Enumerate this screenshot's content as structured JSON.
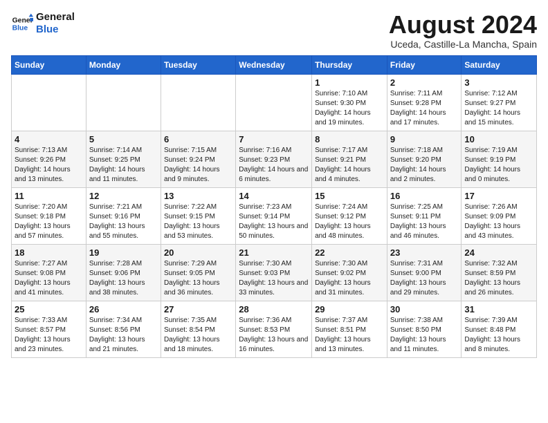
{
  "logo": {
    "line1": "General",
    "line2": "Blue"
  },
  "title": "August 2024",
  "subtitle": "Uceda, Castille-La Mancha, Spain",
  "weekdays": [
    "Sunday",
    "Monday",
    "Tuesday",
    "Wednesday",
    "Thursday",
    "Friday",
    "Saturday"
  ],
  "weeks": [
    [
      {
        "day": "",
        "info": ""
      },
      {
        "day": "",
        "info": ""
      },
      {
        "day": "",
        "info": ""
      },
      {
        "day": "",
        "info": ""
      },
      {
        "day": "1",
        "info": "Sunrise: 7:10 AM\nSunset: 9:30 PM\nDaylight: 14 hours and 19 minutes."
      },
      {
        "day": "2",
        "info": "Sunrise: 7:11 AM\nSunset: 9:28 PM\nDaylight: 14 hours and 17 minutes."
      },
      {
        "day": "3",
        "info": "Sunrise: 7:12 AM\nSunset: 9:27 PM\nDaylight: 14 hours and 15 minutes."
      }
    ],
    [
      {
        "day": "4",
        "info": "Sunrise: 7:13 AM\nSunset: 9:26 PM\nDaylight: 14 hours and 13 minutes."
      },
      {
        "day": "5",
        "info": "Sunrise: 7:14 AM\nSunset: 9:25 PM\nDaylight: 14 hours and 11 minutes."
      },
      {
        "day": "6",
        "info": "Sunrise: 7:15 AM\nSunset: 9:24 PM\nDaylight: 14 hours and 9 minutes."
      },
      {
        "day": "7",
        "info": "Sunrise: 7:16 AM\nSunset: 9:23 PM\nDaylight: 14 hours and 6 minutes."
      },
      {
        "day": "8",
        "info": "Sunrise: 7:17 AM\nSunset: 9:21 PM\nDaylight: 14 hours and 4 minutes."
      },
      {
        "day": "9",
        "info": "Sunrise: 7:18 AM\nSunset: 9:20 PM\nDaylight: 14 hours and 2 minutes."
      },
      {
        "day": "10",
        "info": "Sunrise: 7:19 AM\nSunset: 9:19 PM\nDaylight: 14 hours and 0 minutes."
      }
    ],
    [
      {
        "day": "11",
        "info": "Sunrise: 7:20 AM\nSunset: 9:18 PM\nDaylight: 13 hours and 57 minutes."
      },
      {
        "day": "12",
        "info": "Sunrise: 7:21 AM\nSunset: 9:16 PM\nDaylight: 13 hours and 55 minutes."
      },
      {
        "day": "13",
        "info": "Sunrise: 7:22 AM\nSunset: 9:15 PM\nDaylight: 13 hours and 53 minutes."
      },
      {
        "day": "14",
        "info": "Sunrise: 7:23 AM\nSunset: 9:14 PM\nDaylight: 13 hours and 50 minutes."
      },
      {
        "day": "15",
        "info": "Sunrise: 7:24 AM\nSunset: 9:12 PM\nDaylight: 13 hours and 48 minutes."
      },
      {
        "day": "16",
        "info": "Sunrise: 7:25 AM\nSunset: 9:11 PM\nDaylight: 13 hours and 46 minutes."
      },
      {
        "day": "17",
        "info": "Sunrise: 7:26 AM\nSunset: 9:09 PM\nDaylight: 13 hours and 43 minutes."
      }
    ],
    [
      {
        "day": "18",
        "info": "Sunrise: 7:27 AM\nSunset: 9:08 PM\nDaylight: 13 hours and 41 minutes."
      },
      {
        "day": "19",
        "info": "Sunrise: 7:28 AM\nSunset: 9:06 PM\nDaylight: 13 hours and 38 minutes."
      },
      {
        "day": "20",
        "info": "Sunrise: 7:29 AM\nSunset: 9:05 PM\nDaylight: 13 hours and 36 minutes."
      },
      {
        "day": "21",
        "info": "Sunrise: 7:30 AM\nSunset: 9:03 PM\nDaylight: 13 hours and 33 minutes."
      },
      {
        "day": "22",
        "info": "Sunrise: 7:30 AM\nSunset: 9:02 PM\nDaylight: 13 hours and 31 minutes."
      },
      {
        "day": "23",
        "info": "Sunrise: 7:31 AM\nSunset: 9:00 PM\nDaylight: 13 hours and 29 minutes."
      },
      {
        "day": "24",
        "info": "Sunrise: 7:32 AM\nSunset: 8:59 PM\nDaylight: 13 hours and 26 minutes."
      }
    ],
    [
      {
        "day": "25",
        "info": "Sunrise: 7:33 AM\nSunset: 8:57 PM\nDaylight: 13 hours and 23 minutes."
      },
      {
        "day": "26",
        "info": "Sunrise: 7:34 AM\nSunset: 8:56 PM\nDaylight: 13 hours and 21 minutes."
      },
      {
        "day": "27",
        "info": "Sunrise: 7:35 AM\nSunset: 8:54 PM\nDaylight: 13 hours and 18 minutes."
      },
      {
        "day": "28",
        "info": "Sunrise: 7:36 AM\nSunset: 8:53 PM\nDaylight: 13 hours and 16 minutes."
      },
      {
        "day": "29",
        "info": "Sunrise: 7:37 AM\nSunset: 8:51 PM\nDaylight: 13 hours and 13 minutes."
      },
      {
        "day": "30",
        "info": "Sunrise: 7:38 AM\nSunset: 8:50 PM\nDaylight: 13 hours and 11 minutes."
      },
      {
        "day": "31",
        "info": "Sunrise: 7:39 AM\nSunset: 8:48 PM\nDaylight: 13 hours and 8 minutes."
      }
    ]
  ]
}
